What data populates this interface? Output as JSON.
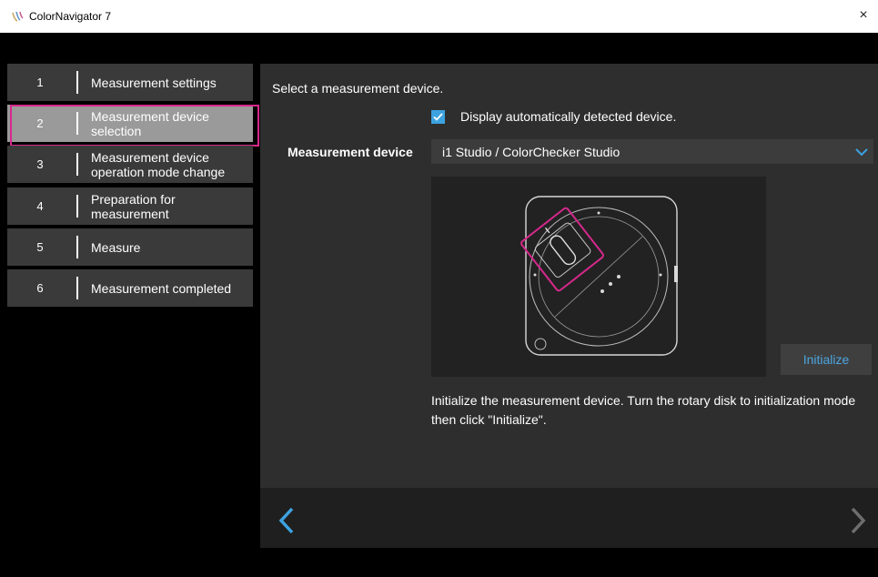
{
  "window": {
    "title": "ColorNavigator 7",
    "close_label": "×",
    "app_icon": "colornavigator-logo-icon"
  },
  "steps": [
    {
      "number": "1",
      "label": "Measurement settings"
    },
    {
      "number": "2",
      "label": "Measurement device selection"
    },
    {
      "number": "3",
      "label": "Measurement device operation mode change"
    },
    {
      "number": "4",
      "label": "Preparation for measurement"
    },
    {
      "number": "5",
      "label": "Measure"
    },
    {
      "number": "6",
      "label": "Measurement completed"
    }
  ],
  "main": {
    "prompt": "Select a measurement device.",
    "auto_detect_label": "Display automatically detected device.",
    "auto_detect_checked": true,
    "device_label": "Measurement device",
    "device_value": "i1 Studio / ColorChecker Studio",
    "initialize_label": "Initialize",
    "description": "Initialize the measurement device. Turn the rotary disk to initialization mode then click \"Initialize\"."
  },
  "colors": {
    "accent": "#3da2e0",
    "highlight": "#d6288c",
    "active_step": "#9a9a9a",
    "step_bg": "#3a3a3a"
  },
  "icons": {
    "back": "chevron-left-icon",
    "next": "chevron-right-icon",
    "dropdown": "chevron-down-icon"
  }
}
